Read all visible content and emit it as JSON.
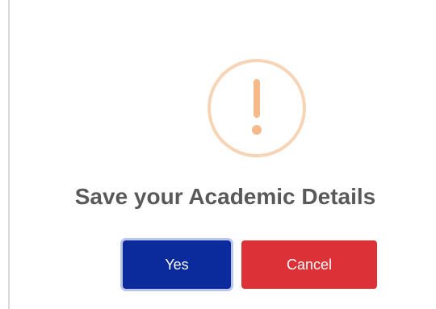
{
  "dialog": {
    "icon": "warning-exclamation-icon",
    "title": "Save your Academic Details",
    "buttons": {
      "confirm_label": "Yes",
      "cancel_label": "Cancel"
    }
  },
  "colors": {
    "icon_ring": "#f8d4b6",
    "icon_mark": "#f6b98b",
    "title_text": "#595959",
    "confirm_button": "#0b2a9c",
    "cancel_button": "#dc3137"
  }
}
